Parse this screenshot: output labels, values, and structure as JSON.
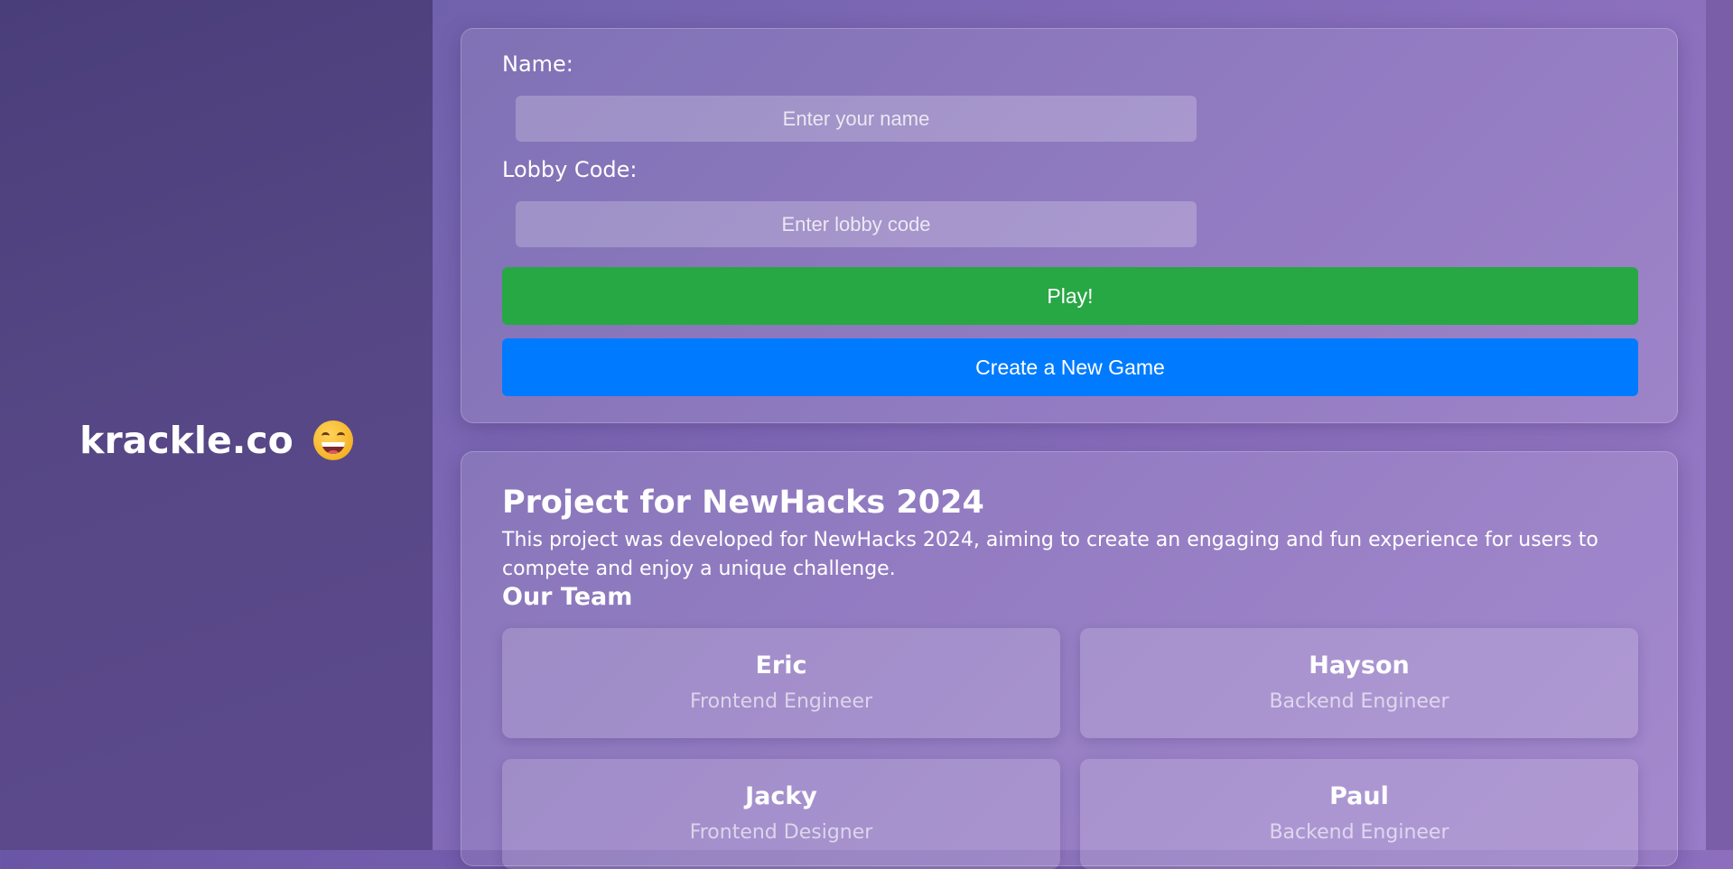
{
  "brand": {
    "name": "krackle.co",
    "emoji_icon": "grinning-squinting-face-icon"
  },
  "form": {
    "name_label": "Name:",
    "name_placeholder": "Enter your name",
    "name_value": "",
    "lobby_label": "Lobby Code:",
    "lobby_placeholder": "Enter lobby code",
    "lobby_value": "",
    "play_label": "Play!",
    "create_label": "Create a New Game"
  },
  "info": {
    "title": "Project for NewHacks 2024",
    "description": "This project was developed for NewHacks 2024, aiming to create an engaging and fun experience for users to compete and enjoy a unique challenge.",
    "team_heading": "Our Team",
    "team": [
      {
        "name": "Eric",
        "role": "Frontend Engineer"
      },
      {
        "name": "Hayson",
        "role": "Backend Engineer"
      },
      {
        "name": "Jacky",
        "role": "Frontend Designer"
      },
      {
        "name": "Paul",
        "role": "Backend Engineer"
      }
    ]
  },
  "colors": {
    "play_button": "#28a745",
    "create_button": "#007bff",
    "sidebar_bg": "#4f4282",
    "main_bg": "#8a6fbd"
  }
}
